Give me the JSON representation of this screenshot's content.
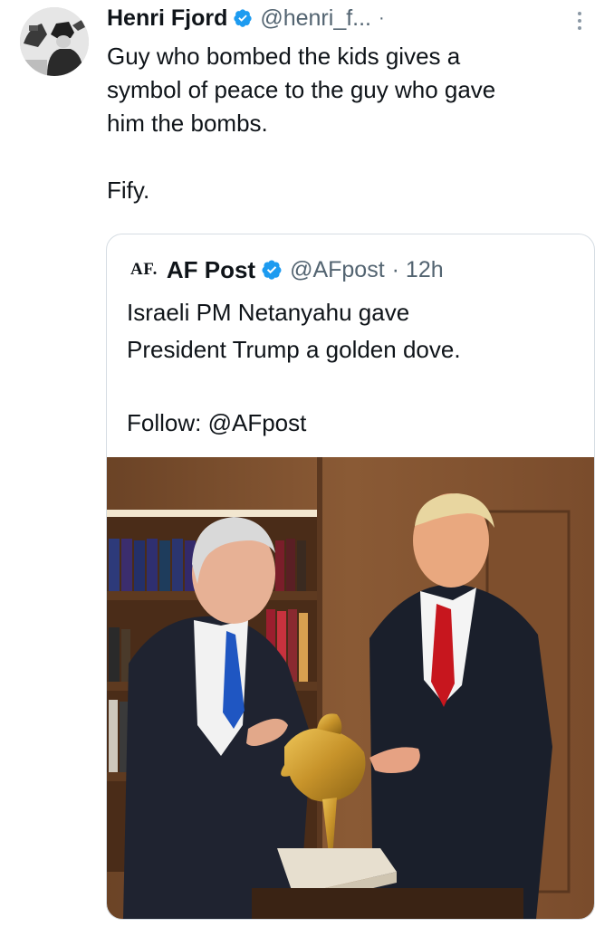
{
  "tweet": {
    "author_name": "Henri Fjord",
    "author_handle": "@henri_f...",
    "separator": "·",
    "avatar_icon": "profile-avatar-illustration",
    "verified_icon": "verified-badge-icon",
    "text_lines": [
      "Guy who bombed the kids gives a",
      "symbol of peace to the guy who gave",
      "him the bombs."
    ],
    "text_2": "Fify."
  },
  "quoted": {
    "logo_text": "AF.",
    "author_name": "AF Post",
    "author_handle": "@AFpost",
    "time": "· 12h",
    "text_lines": [
      "Israeli PM Netanyahu gave",
      "President Trump a golden dove."
    ],
    "text_2": "Follow: @AFpost",
    "photo_alt": "Netanyahu presenting a golden dove sculpture to Trump in a wood-paneled room"
  },
  "colors": {
    "text": "#0f1419",
    "secondary": "#536471",
    "verified": "#1d9bf0",
    "border": "#d6dde3"
  }
}
